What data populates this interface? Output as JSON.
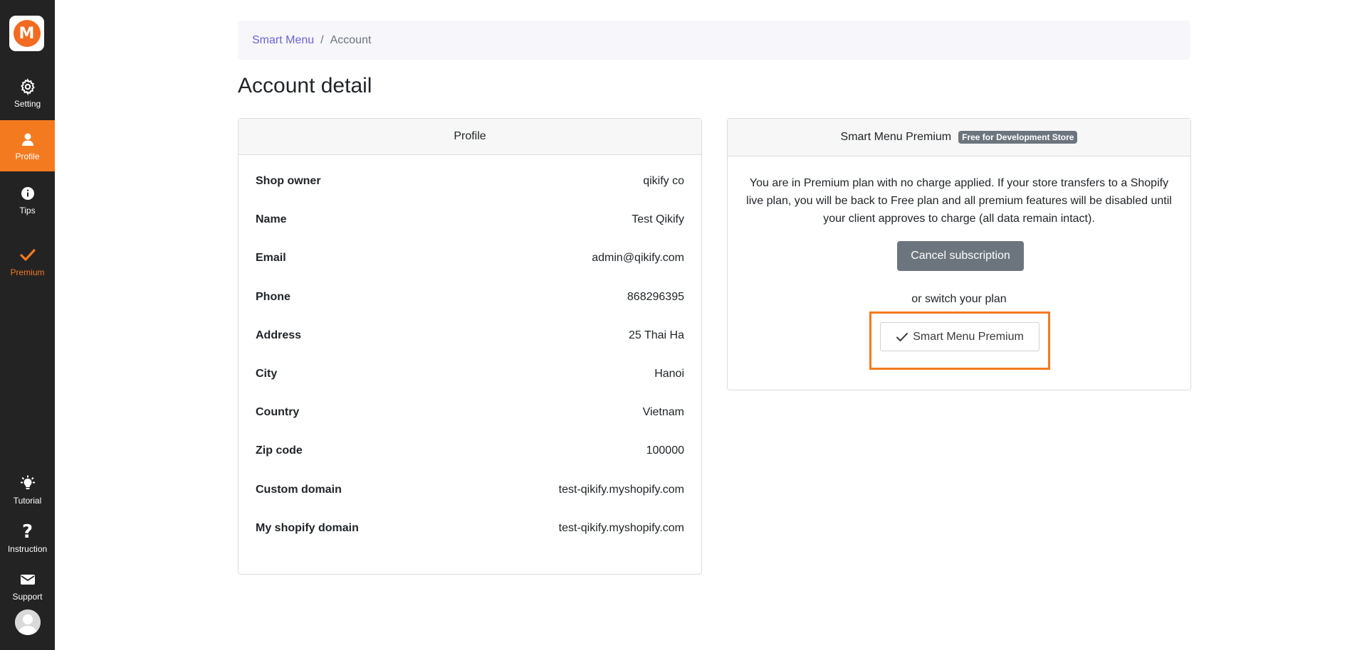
{
  "sidebar": {
    "logo_letter": "M",
    "items": [
      {
        "label": "Setting",
        "icon": "gear-icon"
      },
      {
        "label": "Profile",
        "icon": "user-icon"
      },
      {
        "label": "Tips",
        "icon": "info-icon"
      },
      {
        "label": "Premium",
        "icon": "check-icon"
      },
      {
        "label": "Tutorial",
        "icon": "lightbulb-icon"
      },
      {
        "label": "Instruction",
        "icon": "question-icon"
      },
      {
        "label": "Support",
        "icon": "mail-icon"
      }
    ],
    "accent_color": "#f47a20"
  },
  "breadcrumb": {
    "link": "Smart Menu",
    "separator": "/",
    "current": "Account"
  },
  "page_title": "Account detail",
  "profile": {
    "header": "Profile",
    "rows": [
      {
        "label": "Shop owner",
        "value": "qikify co"
      },
      {
        "label": "Name",
        "value": "Test Qikify"
      },
      {
        "label": "Email",
        "value": "admin@qikify.com"
      },
      {
        "label": "Phone",
        "value": "868296395"
      },
      {
        "label": "Address",
        "value": "25 Thai Ha"
      },
      {
        "label": "City",
        "value": "Hanoi"
      },
      {
        "label": "Country",
        "value": "Vietnam"
      },
      {
        "label": "Zip code",
        "value": "100000"
      },
      {
        "label": "Custom domain",
        "value": "test-qikify.myshopify.com"
      },
      {
        "label": "My shopify domain",
        "value": "test-qikify.myshopify.com"
      }
    ]
  },
  "premium": {
    "header": "Smart Menu Premium",
    "badge": "Free for Development Store",
    "description": "You are in Premium plan with no charge applied. If your store transfers to a Shopify live plan, you will be back to Free plan and all premium features will be disabled until your client approves to charge (all data remain intact).",
    "cancel_label": "Cancel subscription",
    "switch_text": "or switch your plan",
    "plan_button_label": "Smart Menu Premium"
  }
}
